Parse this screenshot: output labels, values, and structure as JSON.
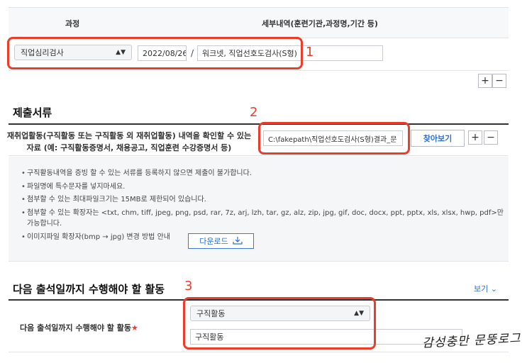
{
  "course_table": {
    "header_course": "과정",
    "header_detail": "세부내역(훈련기관,과정명,기간 등)",
    "course_select_value": "직업심리검사",
    "date_value": "2022/08/26",
    "separator": "/",
    "detail_value": "워크넷, 직업선호도검사(S형)",
    "plus": "+",
    "minus": "−"
  },
  "annotations": {
    "num1": "1",
    "num2": "2",
    "num3": "3"
  },
  "documents": {
    "title": "제출서류",
    "label_line1": "재취업활동(구직활동 또는 구직활동 외 재취업활동) 내역을 확인할 수 있는",
    "label_line2": "자료 (예: 구직활동증명서, 채용공고, 직업훈련 수강증명서 등)",
    "file_path": "C:\\fakepath\\직업선호도검사(S형)결과_문",
    "find_button": "찾아보기",
    "plus": "+",
    "minus": "−"
  },
  "notices": [
    "구직활동내역을 증빙 할 수 있는 서류를 등록하지 않으면 제출이 불가합니다.",
    "파일명에 특수문자를 넣지마세요.",
    "첨부할 수 있는 최대파일크기는 15MB로 제한되어 있습니다.",
    "첨부할 수 있는 확장자는 <txt, chm, tiff, jpeg, png, psd, rar, 7z, arj, lzh, tar, gz, alz, zip, jpg, gif, doc, docx, ppt, pptx, xls, xlsx, hwp, pdf>만 가능합니다.",
    "이미지파일 확장자(bmp → jpg) 변경 방법 안내"
  ],
  "download_button": "다운로드",
  "activity": {
    "title": "다음 출석일까지 수행해야 할 활동",
    "view_link": "보기",
    "label": "다음 출석일까지 수행해야 할 활동",
    "required_mark": "★",
    "select_value": "구직활동",
    "input_value": "구직활동"
  },
  "signature": "감성충만 문뚱로그",
  "colors": {
    "annotation_red": "#ec3d2a",
    "link_blue": "#2a6fd6"
  }
}
